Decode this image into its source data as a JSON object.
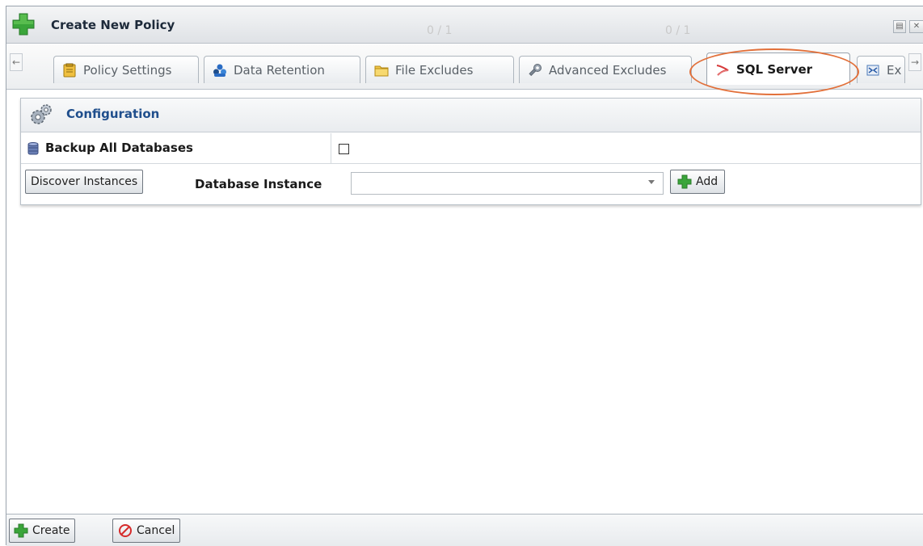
{
  "window": {
    "title": "Create New Policy",
    "ghost_text": [
      "0 / 1",
      "0 / 1"
    ]
  },
  "tabs": [
    {
      "label": "Policy Settings",
      "icon": "clipboard-icon"
    },
    {
      "label": "Data Retention",
      "icon": "people-icon"
    },
    {
      "label": "File Excludes",
      "icon": "folder-icon"
    },
    {
      "label": "Advanced Excludes",
      "icon": "wrench-icon"
    },
    {
      "label": "SQL Server",
      "icon": "sql-server-icon",
      "active": true
    },
    {
      "label": "Ex",
      "icon": "exchange-icon"
    }
  ],
  "configuration": {
    "header": "Configuration",
    "backup_all_label": "Backup All Databases",
    "backup_all_checked": false,
    "discover_button": "Discover Instances",
    "database_instance_label": "Database Instance",
    "database_instance_value": "",
    "add_button": "Add"
  },
  "footer": {
    "create_button": "Create",
    "cancel_button": "Cancel"
  },
  "colors": {
    "accent_blue": "#1f4e8c",
    "highlight_orange": "#e2703a",
    "plus_green": "#3aa53a",
    "cancel_red": "#d62b2b"
  }
}
